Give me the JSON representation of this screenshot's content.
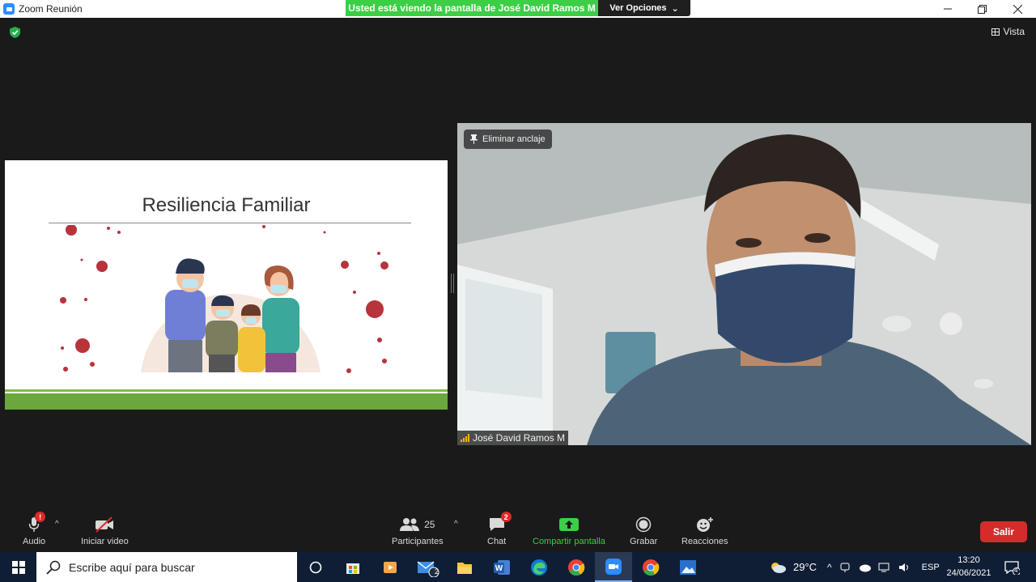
{
  "window": {
    "title": "Zoom Reunión",
    "share_banner": "Usted está viendo la pantalla de José David Ramos M",
    "view_options": "Ver Opciones"
  },
  "meeting": {
    "view_label": "Vista",
    "slide_title": "Resiliencia Familiar",
    "pin_label": "Eliminar anclaje",
    "participant_name": "José David Ramos M"
  },
  "toolbar": {
    "audio": "Audio",
    "audio_badge": "!",
    "video": "Iniciar video",
    "participants": "Participantes",
    "participants_count": "25",
    "chat": "Chat",
    "chat_badge": "2",
    "share": "Compartir pantalla",
    "record": "Grabar",
    "reactions": "Reacciones",
    "leave": "Salir"
  },
  "taskbar": {
    "search_placeholder": "Escribe aquí para buscar",
    "mail_badge": "2",
    "temperature": "29°C",
    "language": "ESP",
    "time": "13:20",
    "date": "24/06/2021",
    "notifications": "4"
  },
  "colors": {
    "share_green": "#3ccf45",
    "leave_red": "#d62b2b",
    "slide_green": "#6aa83e",
    "zoom_blue": "#2d8cff"
  }
}
